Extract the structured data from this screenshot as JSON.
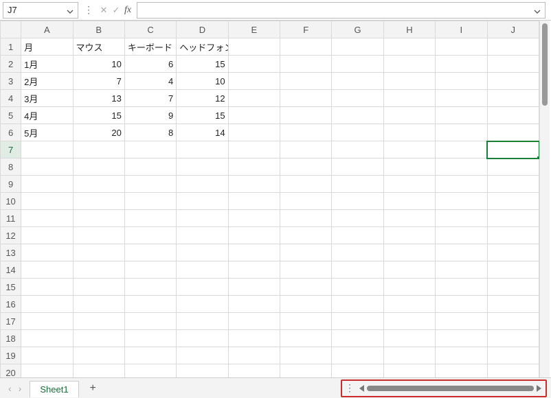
{
  "name_box": {
    "value": "J7"
  },
  "formula_bar": {
    "value": ""
  },
  "columns": [
    "A",
    "B",
    "C",
    "D",
    "E",
    "F",
    "G",
    "H",
    "I",
    "J"
  ],
  "rows_visible": 20,
  "active_cell": {
    "col": "J",
    "row": 7
  },
  "data": {
    "header": {
      "A": "月",
      "B": "マウス",
      "C": "キーボード",
      "D": "ヘッドフォン"
    },
    "rows": [
      {
        "A": "1月",
        "B": 10,
        "C": 6,
        "D": 15
      },
      {
        "A": "2月",
        "B": 7,
        "C": 4,
        "D": 10
      },
      {
        "A": "3月",
        "B": 13,
        "C": 7,
        "D": 12
      },
      {
        "A": "4月",
        "B": 15,
        "C": 9,
        "D": 15
      },
      {
        "A": "5月",
        "B": 20,
        "C": 8,
        "D": 14
      }
    ]
  },
  "sheets": {
    "active": "Sheet1"
  },
  "icons": {
    "nav_prev": "‹",
    "nav_next": "›",
    "add": "+",
    "vdots": "⋮",
    "fx": "fx",
    "cancel": "✕",
    "accept": "✓"
  }
}
